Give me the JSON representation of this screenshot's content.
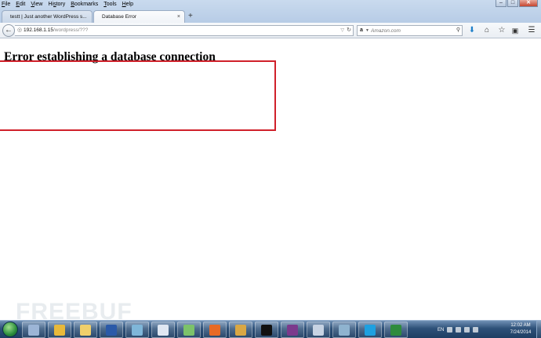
{
  "menubar": {
    "items": [
      {
        "pre": "",
        "key": "F",
        "rest": "ile"
      },
      {
        "pre": "",
        "key": "E",
        "rest": "dit"
      },
      {
        "pre": "",
        "key": "V",
        "rest": "iew"
      },
      {
        "pre": "Hi",
        "key": "s",
        "rest": "tory"
      },
      {
        "pre": "",
        "key": "B",
        "rest": "ookmarks"
      },
      {
        "pre": "",
        "key": "T",
        "rest": "ools"
      },
      {
        "pre": "",
        "key": "H",
        "rest": "elp"
      }
    ]
  },
  "window_controls": {
    "minimize": "–",
    "maximize": "□",
    "close": "✕"
  },
  "tabs": [
    {
      "label": "testt | Just another WordPress s...",
      "active": false
    },
    {
      "label": "Database Error",
      "active": true
    }
  ],
  "tab_close": "×",
  "new_tab_icon": "+",
  "navbar": {
    "url_host": "192.168.1.15",
    "url_path": "/wordpress/???",
    "search_placeholder": "Amazon.com",
    "search_engine_glyph": "a"
  },
  "page": {
    "heading": "Error establishing a database connection",
    "highlight_color": "#d0202a"
  },
  "watermark": "FREEBUF",
  "taskbar": {
    "apps": [
      {
        "name": "explorer-window",
        "color": "#9cb5d6"
      },
      {
        "name": "chrome-icon",
        "color": "#e9b93a"
      },
      {
        "name": "file-explorer-icon",
        "color": "#f0cf6b"
      },
      {
        "name": "word-icon",
        "color": "#2b5aa8"
      },
      {
        "name": "notepad-icon",
        "color": "#7fb6d9"
      },
      {
        "name": "document-icon",
        "color": "#dfe7f2"
      },
      {
        "name": "paint-icon",
        "color": "#7cc26a"
      },
      {
        "name": "firefox-icon",
        "color": "#e86a25"
      },
      {
        "name": "network-icon",
        "color": "#d9a744"
      },
      {
        "name": "cmd-icon",
        "color": "#111111"
      },
      {
        "name": "winrar-icon",
        "color": "#7b3a8c"
      },
      {
        "name": "paint-brush-icon",
        "color": "#c7d3e3"
      },
      {
        "name": "tool-icon",
        "color": "#8fb3cf"
      },
      {
        "name": "skype-icon",
        "color": "#1ea0e0"
      },
      {
        "name": "excel-icon",
        "color": "#2e8b3d"
      }
    ],
    "language": "EN",
    "time": "12:02 AM",
    "date": "7/24/2014"
  }
}
